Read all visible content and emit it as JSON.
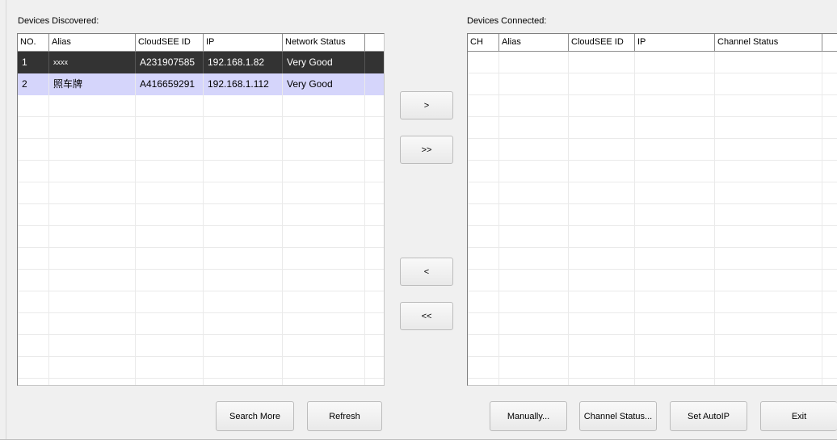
{
  "discovered": {
    "title": "Devices Discovered:",
    "columns": [
      "NO.",
      "Alias",
      "CloudSEE ID",
      "IP",
      "Network Status",
      ""
    ],
    "rows": [
      {
        "no": "1",
        "alias": "xxxx",
        "cloudsee_id": "A231907585",
        "ip": "192.168.1.82",
        "status": "Very Good",
        "state": "selected"
      },
      {
        "no": "2",
        "alias": "照车牌",
        "cloudsee_id": "A416659291",
        "ip": "192.168.1.112",
        "status": "Very Good",
        "state": "hover"
      }
    ]
  },
  "connected": {
    "title": "Devices Connected:",
    "columns": [
      "CH",
      "Alias",
      "CloudSEE ID",
      "IP",
      "Channel Status",
      ""
    ],
    "rows": []
  },
  "transfer_buttons": {
    "add_one": ">",
    "add_all": ">>",
    "remove_one": "<",
    "remove_all": "<<"
  },
  "bottom_buttons": {
    "search_more": "Search More",
    "refresh": "Refresh",
    "manually": "Manually...",
    "channel_status": "Channel Status...",
    "set_autoip": "Set AutoIP",
    "exit": "Exit"
  }
}
